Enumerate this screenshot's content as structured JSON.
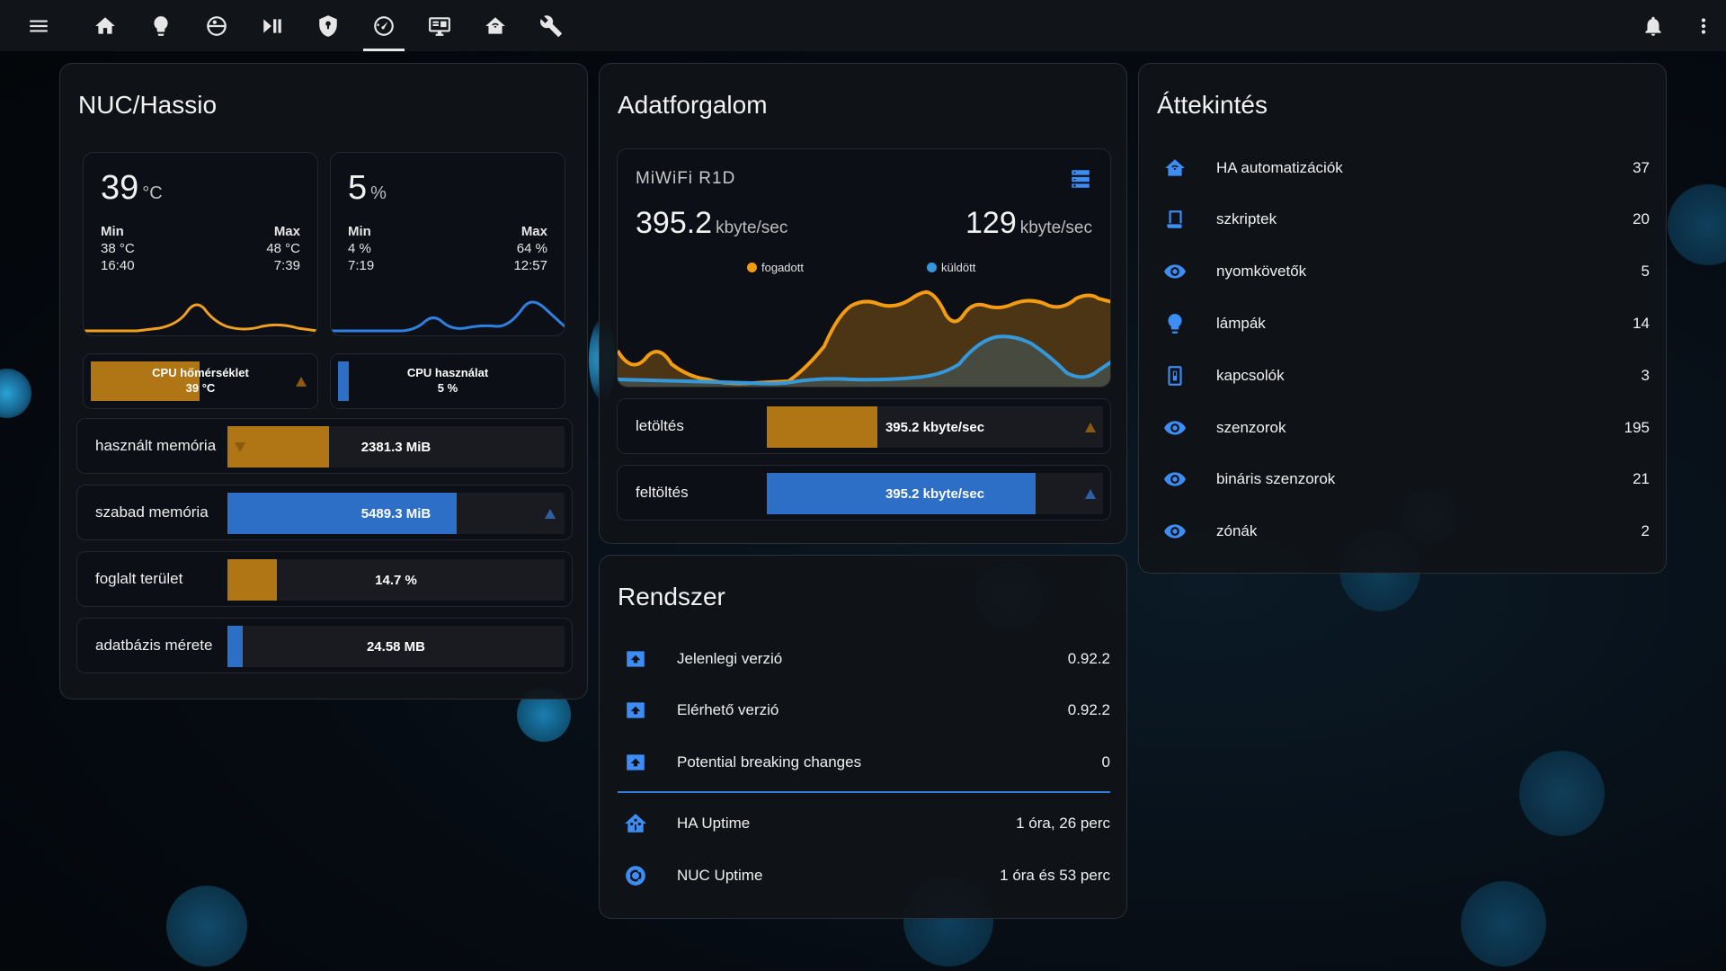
{
  "topbar": {
    "icons": [
      "menu-icon",
      "home-icon",
      "lightbulb-icon",
      "robot-vacuum-icon",
      "play-pause-icon",
      "shield-icon",
      "speedometer-icon",
      "monitor-dashboard-icon",
      "home-automation-icon",
      "wrench-icon",
      "bell-icon",
      "more-vertical-icon"
    ],
    "active": "speedometer-icon"
  },
  "nuc": {
    "title": "NUC/Hassio",
    "temp": {
      "value": "39",
      "unit": "°C",
      "min_label": "Min",
      "min_value": "38 °C",
      "min_time": "16:40",
      "max_label": "Max",
      "max_value": "48 °C",
      "max_time": "7:39",
      "color": "#f0a020"
    },
    "cpu": {
      "value": "5",
      "unit": "%",
      "min_label": "Min",
      "min_value": "4 %",
      "min_time": "7:19",
      "max_label": "Max",
      "max_value": "64 %",
      "max_time": "12:57",
      "color": "#2d7fe0"
    },
    "gauges": [
      {
        "label": "CPU hőmérséklet",
        "value": "39 °C",
        "fraction": 0.52,
        "color": "#b07514",
        "trend": "up"
      },
      {
        "label": "CPU használat",
        "value": "5 %",
        "fraction": 0.05,
        "color": "#2d6fc6",
        "trend": "none"
      }
    ],
    "bars": [
      {
        "label": "használt memória",
        "value": "2381.3 MiB",
        "fraction": 0.3,
        "color": "#b07514",
        "trend": "down"
      },
      {
        "label": "szabad memória",
        "value": "5489.3 MiB",
        "fraction": 0.68,
        "color": "#2d6fc6",
        "trend": "up"
      },
      {
        "label": "foglalt terület",
        "value": "14.7 %",
        "fraction": 0.147,
        "color": "#b07514",
        "trend": "none"
      },
      {
        "label": "adatbázis mérete",
        "value": "24.58 MB",
        "fraction": 0.045,
        "color": "#2d6fc6",
        "trend": "none"
      }
    ]
  },
  "traffic": {
    "title": "Adatforgalom",
    "device": "MiWiFi R1D",
    "received": {
      "value": "395.2",
      "unit": "kbyte/sec",
      "legend": "fogadott",
      "color": "#f39c12"
    },
    "sent": {
      "value": "129",
      "unit": "kbyte/sec",
      "legend": "küldött",
      "color": "#3498db"
    },
    "bars": [
      {
        "label": "letöltés",
        "value": "395.2 kbyte/sec",
        "fraction": 0.33,
        "color": "#b07514",
        "trend": "up"
      },
      {
        "label": "feltöltés",
        "value": "395.2 kbyte/sec",
        "fraction": 0.8,
        "color": "#2d6fc6",
        "trend": "up"
      }
    ]
  },
  "system": {
    "title": "Rendszer",
    "rows": [
      {
        "icon": "package-up-icon",
        "label": "Jelenlegi verzió",
        "value": "0.92.2"
      },
      {
        "icon": "package-up-icon",
        "label": "Elérhető verzió",
        "value": "0.92.2"
      },
      {
        "icon": "package-up-icon",
        "label": "Potential breaking changes",
        "value": "0"
      }
    ],
    "uptime": [
      {
        "icon": "home-assistant-icon",
        "label": "HA Uptime",
        "value": "1 óra, 26 perc"
      },
      {
        "icon": "ubuntu-icon",
        "label": "NUC Uptime",
        "value": "1 óra és 53 perc"
      }
    ]
  },
  "overview": {
    "title": "Áttekintés",
    "rows": [
      {
        "icon": "home-automation-icon",
        "label": "HA automatizációk",
        "value": "37"
      },
      {
        "icon": "script-icon",
        "label": "szkriptek",
        "value": "20"
      },
      {
        "icon": "eye-icon",
        "label": "nyomkövetők",
        "value": "5"
      },
      {
        "icon": "lightbulb-icon",
        "label": "lámpák",
        "value": "14"
      },
      {
        "icon": "light-switch-icon",
        "label": "kapcsolók",
        "value": "3"
      },
      {
        "icon": "eye-icon",
        "label": "szenzorok",
        "value": "195"
      },
      {
        "icon": "eye-icon",
        "label": "bináris szenzorok",
        "value": "21"
      },
      {
        "icon": "eye-icon",
        "label": "zónák",
        "value": "2"
      }
    ]
  }
}
